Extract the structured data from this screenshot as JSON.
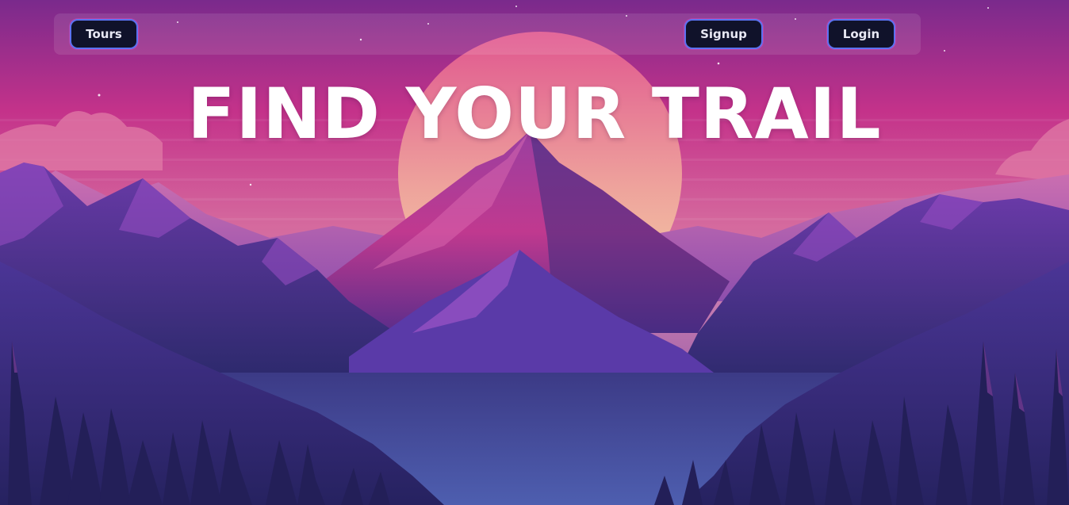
{
  "nav": {
    "tours_label": "Tours",
    "signup_label": "Signup",
    "login_label": "Login"
  },
  "hero": {
    "title": "FIND YOUR TRAIL"
  },
  "colors": {
    "sky_top": "#7a2a8c",
    "sky_mid": "#c9337f",
    "sun": "#f2c39a",
    "mountain_dark": "#2e2a6e",
    "mountain_light": "#8a3fb8",
    "button_bg": "#10122a",
    "button_border": "#5b72f0"
  },
  "background": {
    "icon": "mountain-landscape-illustration"
  }
}
